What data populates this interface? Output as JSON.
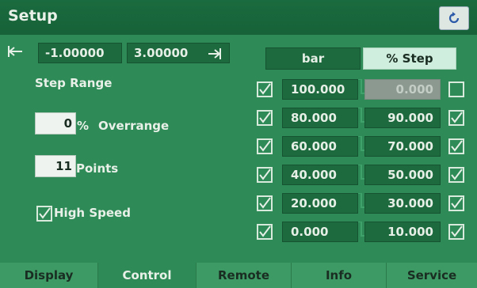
{
  "title": "Setup",
  "range": {
    "low": "-1.00000",
    "high": "3.00000"
  },
  "unit_buttons": [
    {
      "label": "bar",
      "active": false
    },
    {
      "label": "% Step",
      "active": true
    }
  ],
  "step_range_label": "Step Range",
  "overrange": {
    "value": "0",
    "unit": "%",
    "label": "Overrange"
  },
  "points": {
    "value": "11",
    "label": "Points"
  },
  "high_speed": {
    "label": "High Speed",
    "checked": true
  },
  "steps": [
    {
      "left_checked": true,
      "left": "100.000",
      "right": "0.000",
      "right_checked": false,
      "right_disabled": true
    },
    {
      "left_checked": true,
      "left": "80.000",
      "right": "90.000",
      "right_checked": true,
      "right_disabled": false
    },
    {
      "left_checked": true,
      "left": "60.000",
      "right": "70.000",
      "right_checked": true,
      "right_disabled": false
    },
    {
      "left_checked": true,
      "left": "40.000",
      "right": "50.000",
      "right_checked": true,
      "right_disabled": false
    },
    {
      "left_checked": true,
      "left": "20.000",
      "right": "30.000",
      "right_checked": true,
      "right_disabled": false
    },
    {
      "left_checked": true,
      "left": "0.000",
      "right": "10.000",
      "right_checked": true,
      "right_disabled": false
    }
  ],
  "tabs": [
    {
      "label": "Display",
      "active": false
    },
    {
      "label": "Control",
      "active": true
    },
    {
      "label": "Remote",
      "active": false
    },
    {
      "label": "Info",
      "active": false
    },
    {
      "label": "Service",
      "active": false
    }
  ],
  "icons": {
    "refresh": "refresh-icon",
    "range_low": "arrow-left-bar-icon",
    "range_high": "arrow-right-bar-icon"
  },
  "colors": {
    "panel": "#2e8b57",
    "field": "#1d6a3e",
    "active_button": "#cfeede",
    "titlebar": "#1a6b3f"
  }
}
